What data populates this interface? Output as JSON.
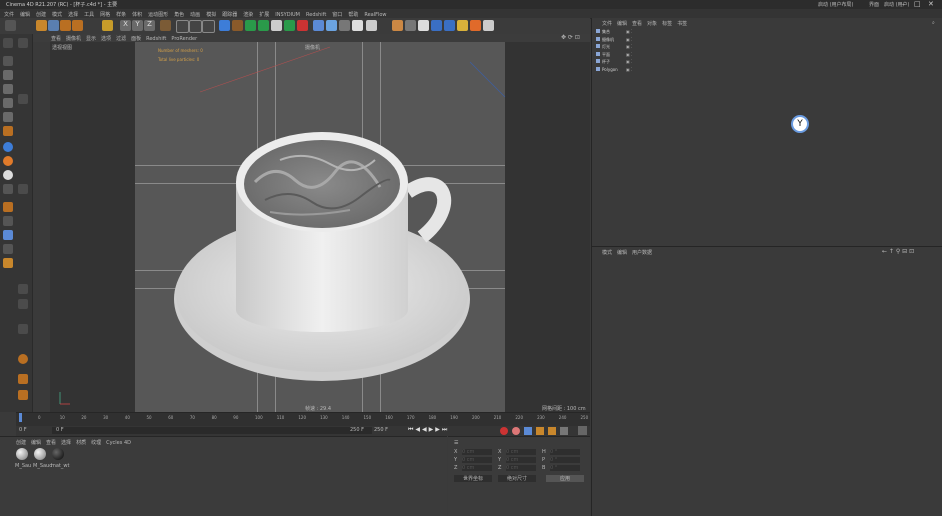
{
  "window": {
    "title": "Cinema 4D R21.207 (RC) - [杯子.c4d *] - 主要",
    "layout_label": "启动 (用户布局)",
    "search_label": "界面",
    "search_value": "启动 (用户)"
  },
  "menu": [
    "文件",
    "编辑",
    "创建",
    "模式",
    "选择",
    "工具",
    "网格",
    "样条",
    "体积",
    "运动图形",
    "角色",
    "动画",
    "模拟",
    "跟踪器",
    "渲染",
    "扩展",
    "INSYDIUM",
    "Redshift",
    "窗口",
    "帮助",
    "RealFlow"
  ],
  "viewport": {
    "menu": [
      "查看",
      "摄像机",
      "显示",
      "选项",
      "过滤",
      "面板",
      "Redshift",
      "ProRender"
    ],
    "label": "透视视图",
    "camera_label": "摄像机",
    "hud_meshers": "Number of meshers: 0",
    "hud_particles": "Total live particles: 0",
    "fps_label": "帧速 : 29.4",
    "grid_label": "网格间距 : 100 cm"
  },
  "timeline": {
    "ticks": [
      "0",
      "10",
      "20",
      "30",
      "40",
      "50",
      "60",
      "70",
      "80",
      "90",
      "100",
      "110",
      "120",
      "130",
      "140",
      "150",
      "160",
      "170",
      "180",
      "190",
      "200",
      "210",
      "220",
      "230",
      "240",
      "250"
    ],
    "current_frame": "0 F",
    "start": "0 F",
    "end": "250 F",
    "end2": "250 F"
  },
  "materials": {
    "menu": [
      "创建",
      "编辑",
      "查看",
      "选择",
      "材质",
      "纹理",
      "Cycles 4D"
    ],
    "items": [
      "M_Sau",
      "M_Saud",
      "mat_wt"
    ]
  },
  "coords": {
    "rows": [
      {
        "a": "X",
        "av": "0 cm",
        "b": "X",
        "bv": "0 cm",
        "c": "H",
        "cv": "0 °"
      },
      {
        "a": "Y",
        "av": "0 cm",
        "b": "Y",
        "bv": "0 cm",
        "c": "P",
        "cv": "0 °"
      },
      {
        "a": "Z",
        "av": "0 cm",
        "b": "Z",
        "bv": "0 cm",
        "c": "B",
        "cv": "0 °"
      }
    ],
    "mode": "世界坐标",
    "scale": "绝对尺寸",
    "apply": "应用"
  },
  "object_manager": {
    "menu": [
      "文件",
      "编辑",
      "查看",
      "对象",
      "标签",
      "书签"
    ],
    "objects": [
      "集合",
      "摄像机",
      "灯光",
      "平面",
      "杯子",
      "Polygon"
    ]
  },
  "attr_manager": {
    "menu": [
      "模式",
      "编辑",
      "用户数据"
    ]
  }
}
